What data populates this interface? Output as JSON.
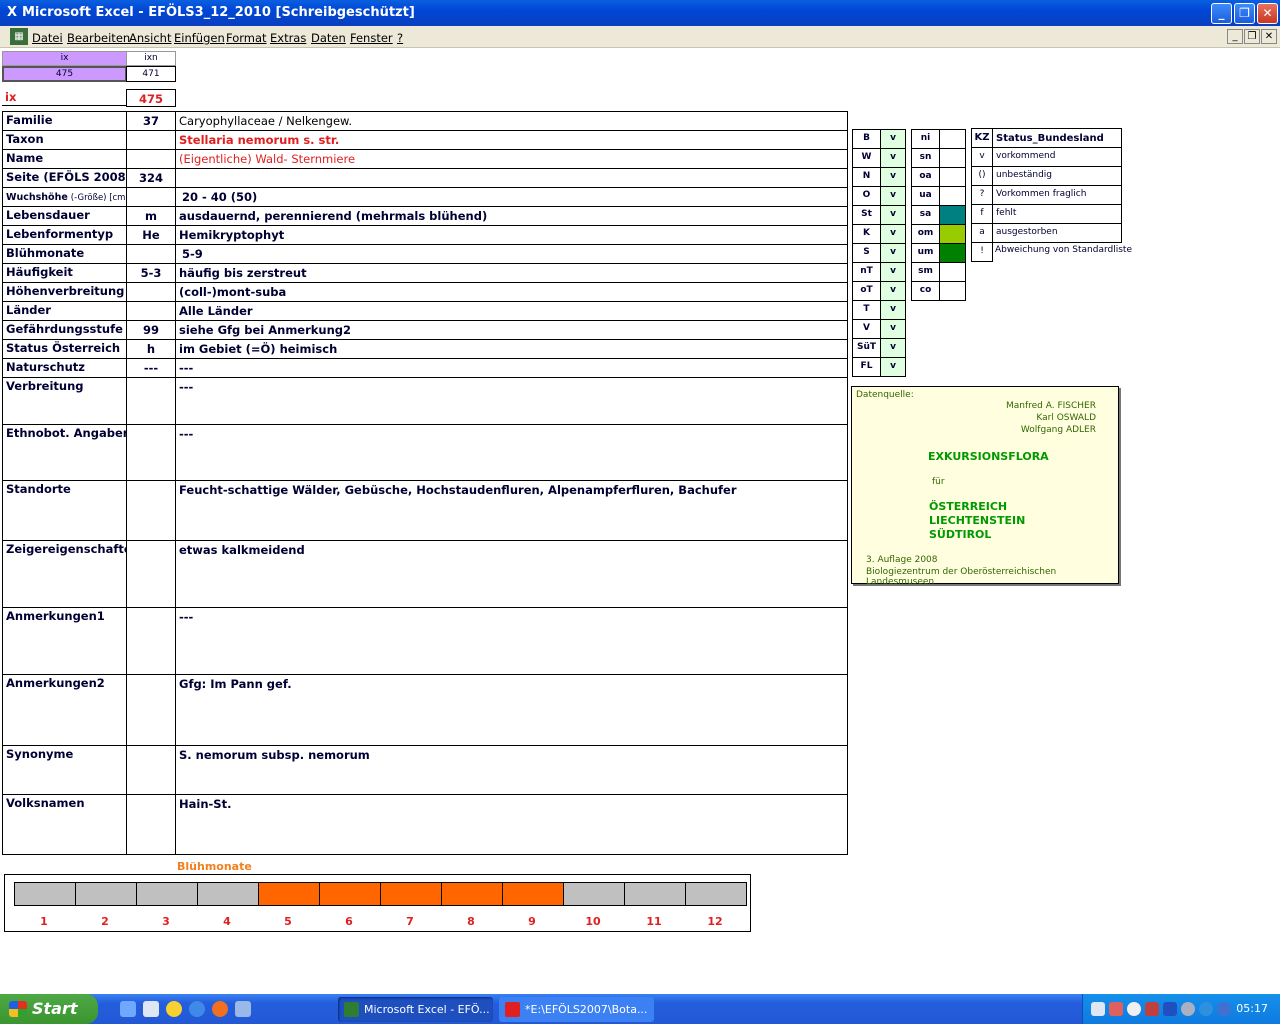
{
  "window": {
    "title": "Microsoft Excel - EFÖLS3_12_2010  [Schreibgeschützt]",
    "app_icon": "X"
  },
  "title_buttons": {
    "minimize": "_",
    "restore": "❐",
    "close": "✕"
  },
  "menu": {
    "items": [
      "Datei",
      "Bearbeiten",
      "Ansicht",
      "Einfügen",
      "Format",
      "Extras",
      "Daten",
      "Fenster",
      "?"
    ],
    "doc_buttons": {
      "minimize": "_",
      "restore": "❐",
      "close": "✕"
    }
  },
  "top_cells": {
    "ix_header": "ix",
    "ixn_header": "ixn",
    "ix_value": "475",
    "ixn_value": "471",
    "ix_label": "ix",
    "ix_big": "475"
  },
  "record": {
    "rows": [
      {
        "label": "Familie",
        "code": "37",
        "value": "Caryophyllaceae  /  Nelkengew.",
        "style": "plain"
      },
      {
        "label": "Taxon",
        "code": "",
        "value": "Stellaria nemorum s. str.",
        "style": "redbold"
      },
      {
        "label": "Name",
        "code": "",
        "value": "(Eigentliche) Wald- Sternmiere",
        "style": "red"
      },
      {
        "label": "Seite (EFÖLS 2008)",
        "code": "324",
        "value": "",
        "style": "plain"
      },
      {
        "label": "Wuchshöhe",
        "label_suffix": "(-Größe) [cm]",
        "code": "",
        "value": "20 - 40 (50)",
        "style": "bold"
      },
      {
        "label": "Lebensdauer",
        "code": "m",
        "value": "ausdauernd, perennierend (mehrmals blühend)",
        "style": "bold"
      },
      {
        "label": "Lebenformentyp",
        "code": "He",
        "value": "Hemikryptophyt",
        "style": "bold"
      },
      {
        "label": "Blühmonate",
        "code": "",
        "value": "5-9",
        "style": "bold"
      },
      {
        "label": "Häufigkeit",
        "code": "5-3",
        "value": "häufig bis zerstreut",
        "style": "bold"
      },
      {
        "label": "Höhenverbreitung",
        "code": "",
        "value": "(coll-)mont-suba",
        "style": "bold"
      },
      {
        "label": "Länder",
        "code": "",
        "value": "Alle Länder",
        "style": "bold"
      },
      {
        "label": "Gefährdungsstufe",
        "code": "99",
        "value": "siehe Gfg bei Anmerkung2",
        "style": "bold"
      },
      {
        "label": "Status Österreich",
        "code": "h",
        "value": "im Gebiet (=Ö) heimisch",
        "style": "bold"
      },
      {
        "label": "Naturschutz",
        "code": "---",
        "value": "---",
        "style": "bold"
      },
      {
        "label": "Verbreitung",
        "code": "",
        "value": "---",
        "style": "bold"
      },
      {
        "label": "Ethnobot. Angaben",
        "code": "",
        "value": "---",
        "style": "bold"
      },
      {
        "label": "Standorte",
        "code": "",
        "value": "Feucht-schattige Wälder, Gebüsche, Hochstaudenfluren, Alpenampferfluren, Bachufer",
        "style": "bold"
      },
      {
        "label": "Zeigereigenschaften",
        "code": "",
        "value": "etwas kalkmeidend",
        "style": "bold"
      },
      {
        "label": "Anmerkungen1",
        "code": "",
        "value": "---",
        "style": "bold"
      },
      {
        "label": "Anmerkungen2",
        "code": "",
        "value": "Gfg: Im Pann gef.",
        "style": "bold"
      },
      {
        "label": "Synonyme",
        "code": "",
        "value": "S. nemorum subsp. nemorum",
        "style": "bold"
      },
      {
        "label": "Volksnamen",
        "code": "",
        "value": "Hain-St.",
        "style": "bold"
      }
    ]
  },
  "states": [
    {
      "abbr": "B",
      "val": "v"
    },
    {
      "abbr": "W",
      "val": "v"
    },
    {
      "abbr": "N",
      "val": "v"
    },
    {
      "abbr": "O",
      "val": "v"
    },
    {
      "abbr": "St",
      "val": "v"
    },
    {
      "abbr": "K",
      "val": "v"
    },
    {
      "abbr": "S",
      "val": "v"
    },
    {
      "abbr": "nT",
      "val": "v"
    },
    {
      "abbr": "oT",
      "val": "v"
    },
    {
      "abbr": "T",
      "val": "v"
    },
    {
      "abbr": "V",
      "val": "v"
    },
    {
      "abbr": "SüT",
      "val": "v"
    },
    {
      "abbr": "FL",
      "val": "v"
    }
  ],
  "zones": [
    {
      "abbr": "ni",
      "color": ""
    },
    {
      "abbr": "sn",
      "color": ""
    },
    {
      "abbr": "oa",
      "color": ""
    },
    {
      "abbr": "ua",
      "color": ""
    },
    {
      "abbr": "sa",
      "color": "#008080"
    },
    {
      "abbr": "om",
      "color": "#99cc00"
    },
    {
      "abbr": "um",
      "color": "#008000"
    },
    {
      "abbr": "sm",
      "color": ""
    },
    {
      "abbr": "co",
      "color": ""
    }
  ],
  "legend": {
    "kz_header": "KZ",
    "status_header": "Status_Bundesland",
    "items": [
      {
        "kz": "v",
        "text": "vorkommend"
      },
      {
        "kz": "()",
        "text": "unbeständig"
      },
      {
        "kz": "?",
        "text": "Vorkommen fraglich"
      },
      {
        "kz": "f",
        "text": "fehlt"
      },
      {
        "kz": "a",
        "text": "ausgestorben"
      },
      {
        "kz": "!",
        "text": "Abweichung von Standardliste(?)"
      }
    ]
  },
  "source": {
    "label": "Datenquelle:",
    "authors": [
      "Manfred A. FISCHER",
      "Karl OSWALD",
      "Wolfgang ADLER"
    ],
    "title": "EXKURSIONSFLORA",
    "fuer": "für",
    "countries": [
      "ÖSTERREICH",
      "LIECHTENSTEIN",
      "SÜDTIROL"
    ],
    "edition": "3. Auflage 2008",
    "publisher": "Biologiezentrum der Oberösterreichischen Landesmuseen"
  },
  "bloom": {
    "title": "Blühmonate",
    "months": [
      1,
      2,
      3,
      4,
      5,
      6,
      7,
      8,
      9,
      10,
      11,
      12
    ],
    "active": [
      5,
      6,
      7,
      8,
      9
    ],
    "active_color": "#ff6600",
    "inactive_color": "#c0c0c0"
  },
  "taskbar": {
    "start": "Start",
    "tasks": [
      "Microsoft Excel - EFÖ...",
      "*E:\\EFÖLS2007\\Bota..."
    ],
    "clock": "05:17"
  }
}
